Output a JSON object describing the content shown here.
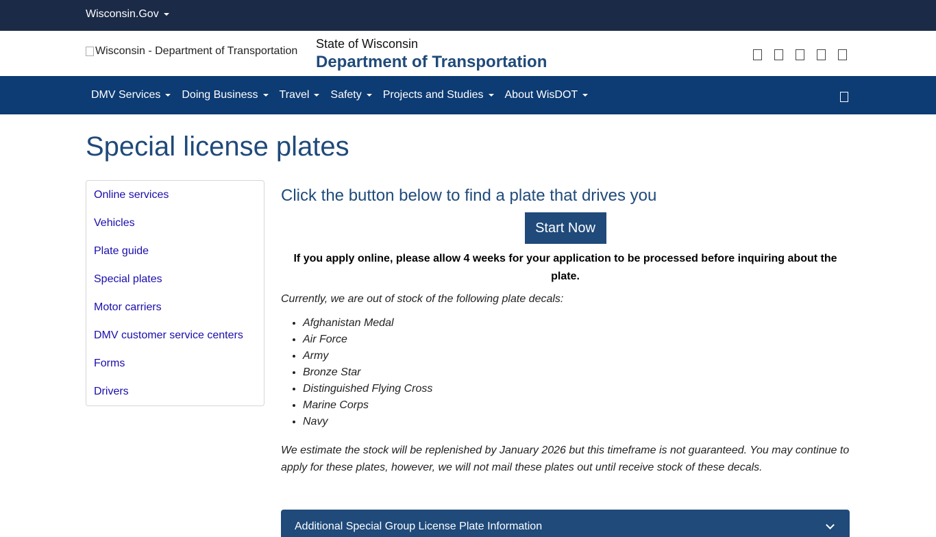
{
  "topbar": {
    "gov_label": "Wisconsin.Gov"
  },
  "header": {
    "logo_alt": "Wisconsin - Department of Transportation",
    "state": "State of Wisconsin",
    "department": "Department of Transportation"
  },
  "nav": {
    "items": [
      {
        "label": "DMV Services"
      },
      {
        "label": "Doing Business"
      },
      {
        "label": "Travel"
      },
      {
        "label": "Safety"
      },
      {
        "label": "Projects and Studies"
      },
      {
        "label": "About WisDOT"
      }
    ]
  },
  "page": {
    "title": "Special license plates"
  },
  "sidebar": {
    "items": [
      {
        "label": "Online services"
      },
      {
        "label": "Vehicles"
      },
      {
        "label": "Plate guide"
      },
      {
        "label": "Special plates"
      },
      {
        "label": "Motor carriers"
      },
      {
        "label": "DMV customer service centers"
      },
      {
        "label": "Forms"
      },
      {
        "label": "Drivers"
      }
    ]
  },
  "main": {
    "heading": "Click the button below to find a plate that drives you",
    "start_button": "Start Now",
    "notice": "If you apply online, please allow 4 weeks for your application to be processed before inquiring about the plate.",
    "intro": "Currently, we are out of stock of the following plate decals:",
    "decals": [
      "Afghanistan Medal",
      "Air Force",
      "Army",
      "Bronze Star",
      "Distinguished Flying Cross",
      "Marine Corps",
      "Navy"
    ],
    "estimate": "We estimate the stock will be replenished by January 2026 but this timeframe is not guaranteed. You may continue to apply for these plates, however, we will not mail these plates out until receive stock of these decals.",
    "accordion_title": "Additional Special Group License Plate Information"
  }
}
